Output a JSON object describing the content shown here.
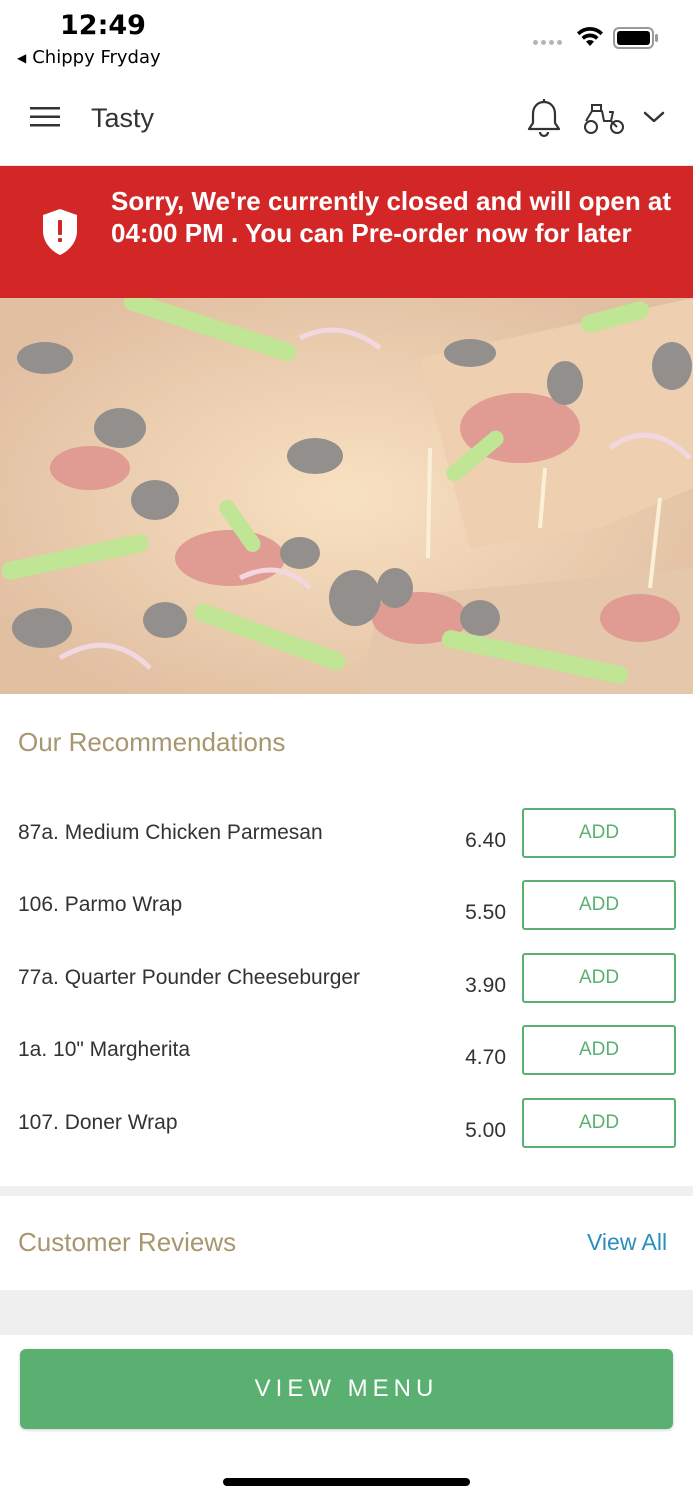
{
  "status_bar": {
    "time": "12:49",
    "back_app": "Chippy Fryday",
    "back_icon": "back-triangle-icon",
    "wifi_icon": "wifi-icon",
    "battery_icon": "battery-icon"
  },
  "header": {
    "title": "Tasty",
    "menu_icon": "hamburger-menu-icon",
    "notification_icon": "bell-icon",
    "delivery_icon": "scooter-icon",
    "dropdown_icon": "chevron-down-icon"
  },
  "alert": {
    "icon": "shield-exclamation-icon",
    "message": "Sorry, We're currently closed and will open at 04:00 PM . You can Pre-order now for later",
    "color": "#d32727"
  },
  "hero": {
    "image": "pizza-photo"
  },
  "recommendations": {
    "heading": "Our Recommendations",
    "items": [
      {
        "name": "87a. Medium Chicken Parmesan",
        "price": "6.40",
        "action": "ADD"
      },
      {
        "name": "106. Parmo Wrap",
        "price": "5.50",
        "action": "ADD"
      },
      {
        "name": "77a. Quarter Pounder Cheeseburger",
        "price": "3.90",
        "action": "ADD"
      },
      {
        "name": "1a. 10\" Margherita",
        "price": "4.70",
        "action": "ADD"
      },
      {
        "name": "107. Doner Wrap",
        "price": "5.00",
        "action": "ADD"
      }
    ]
  },
  "reviews": {
    "heading": "Customer Reviews",
    "view_all": "View All"
  },
  "footer": {
    "view_menu": "VIEW MENU"
  },
  "colors": {
    "accent_green": "#5ab070",
    "heading_tan": "#a8966f",
    "link_blue": "#2a8fbd",
    "alert_red": "#d32727"
  }
}
